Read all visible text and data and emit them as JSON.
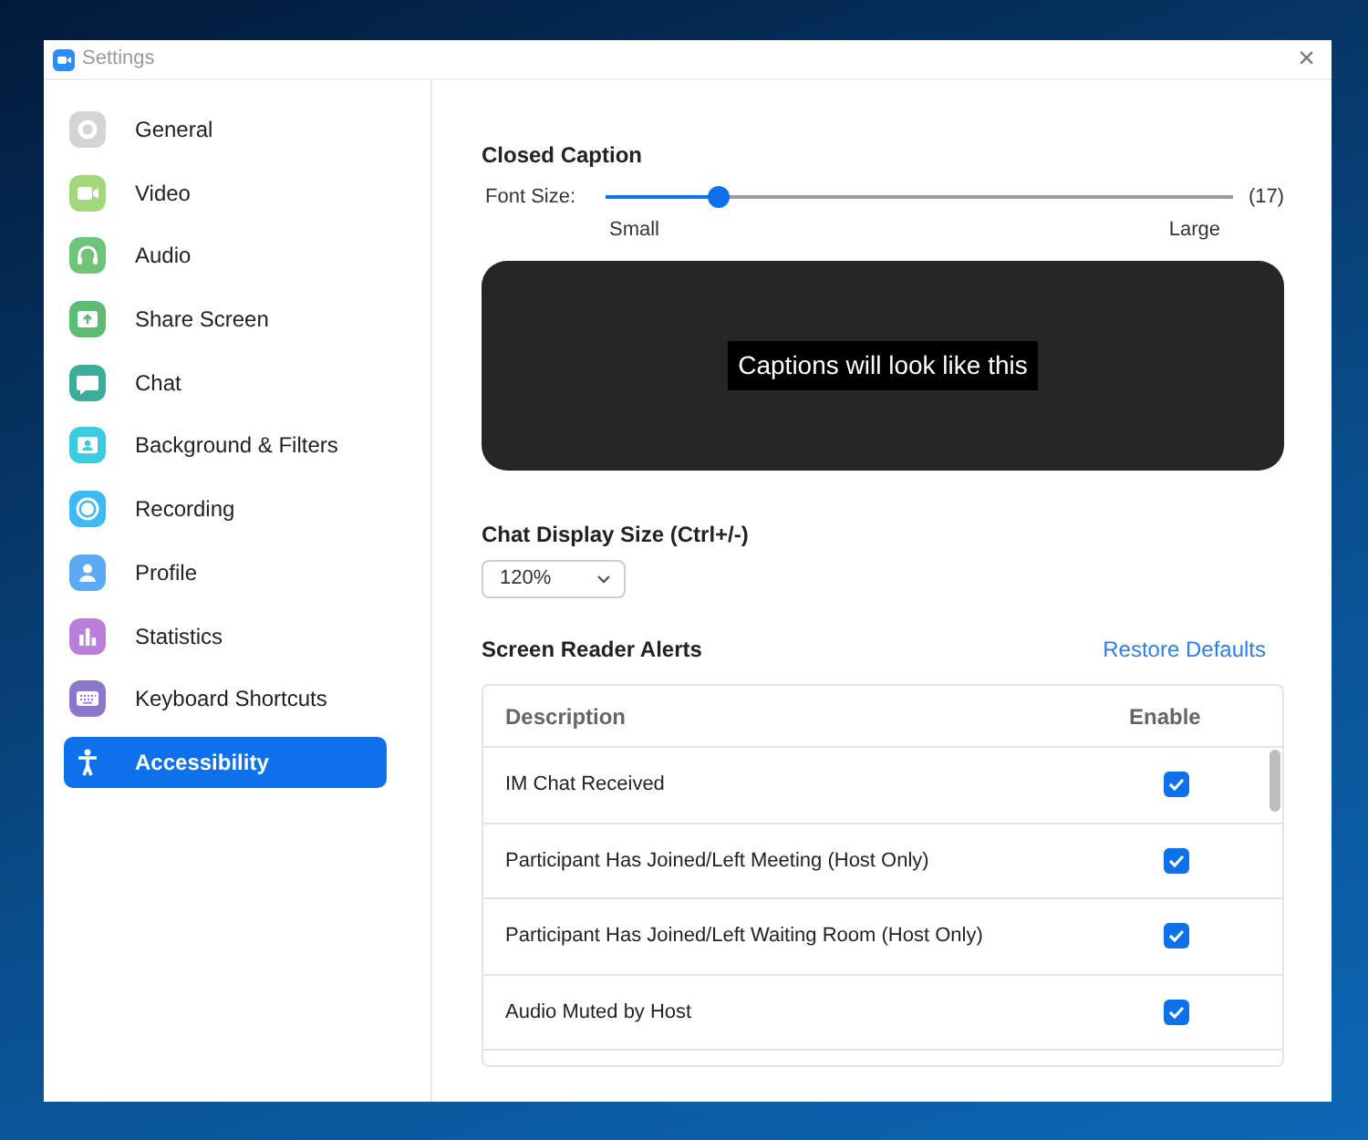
{
  "window": {
    "title": "Settings",
    "close": "×"
  },
  "sidebar": {
    "items": [
      {
        "label": "General",
        "kind": "gear",
        "color": "#d4d4d4",
        "selected": false
      },
      {
        "label": "Video",
        "kind": "video",
        "color": "#a3d77c",
        "selected": false
      },
      {
        "label": "Audio",
        "kind": "headphones",
        "color": "#6fc47a",
        "selected": false
      },
      {
        "label": "Share Screen",
        "kind": "share",
        "color": "#5dbb73",
        "selected": false
      },
      {
        "label": "Chat",
        "kind": "chat",
        "color": "#3aae98",
        "selected": false
      },
      {
        "label": "Background & Filters",
        "kind": "background",
        "color": "#3dcbe0",
        "selected": false
      },
      {
        "label": "Recording",
        "kind": "record",
        "color": "#3fb9f3",
        "selected": false
      },
      {
        "label": "Profile",
        "kind": "profile",
        "color": "#5caaf3",
        "selected": false
      },
      {
        "label": "Statistics",
        "kind": "stats",
        "color": "#b97fd9",
        "selected": false
      },
      {
        "label": "Keyboard Shortcuts",
        "kind": "keyboard",
        "color": "#8b78cc",
        "selected": false
      },
      {
        "label": "Accessibility",
        "kind": "person",
        "selected": true
      }
    ]
  },
  "closed_caption": {
    "title": "Closed Caption",
    "font_size_label": "Font Size:",
    "level": 0.18,
    "reading": "(17)",
    "min_label": "Small",
    "max_label": "Large",
    "preview": "Captions will look like this"
  },
  "chat_display": {
    "title": "Chat Display Size (Ctrl+/-)",
    "value": "120%"
  },
  "screen_reader": {
    "title": "Screen Reader Alerts",
    "restore": "Restore Defaults",
    "columns": [
      "Description",
      "Enable"
    ],
    "rows": [
      {
        "description": "IM Chat Received",
        "checked": true
      },
      {
        "description": "Participant Has Joined/Left Meeting (Host Only)",
        "checked": true
      },
      {
        "description": "Participant Has Joined/Left Waiting Room (Host Only)",
        "checked": true
      },
      {
        "description": "Audio Muted by Host",
        "checked": true
      }
    ]
  }
}
